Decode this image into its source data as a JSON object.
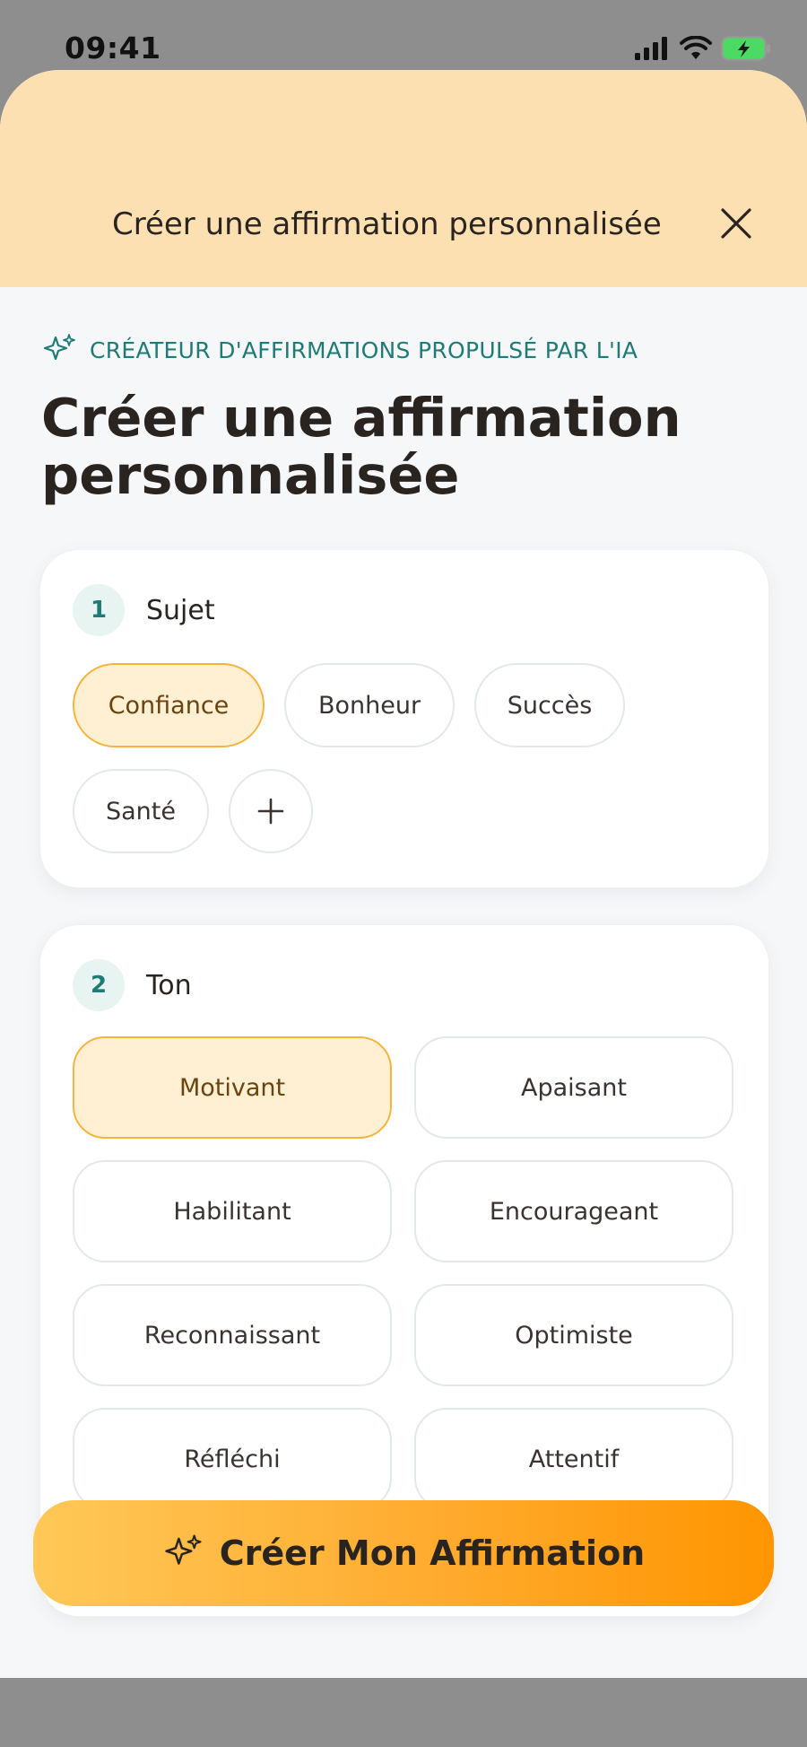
{
  "status_bar": {
    "time": "09:41"
  },
  "header": {
    "title": "Créer une affirmation personnalisée",
    "close_icon": "close-icon"
  },
  "intro": {
    "overline": "CRÉATEUR D'AFFIRMATIONS PROPULSÉ PAR L'IA",
    "title": "Créer une affirmation personnalisée"
  },
  "subject": {
    "step_number": "1",
    "label": "Sujet",
    "chips": [
      "Confiance",
      "Bonheur",
      "Succès",
      "Santé"
    ],
    "selected": "Confiance"
  },
  "tone": {
    "step_number": "2",
    "label": "Ton",
    "options": [
      "Motivant",
      "Apaisant",
      "Habilitant",
      "Encourageant",
      "Reconnaissant",
      "Optimiste",
      "Réfléchi",
      "Attentif"
    ],
    "selected": "Motivant"
  },
  "cta": {
    "label": "Créer Mon Affirmation"
  },
  "colors": {
    "accent": "#f5b53d",
    "teal": "#1f7b76",
    "header_bg": "#fde0b2"
  }
}
